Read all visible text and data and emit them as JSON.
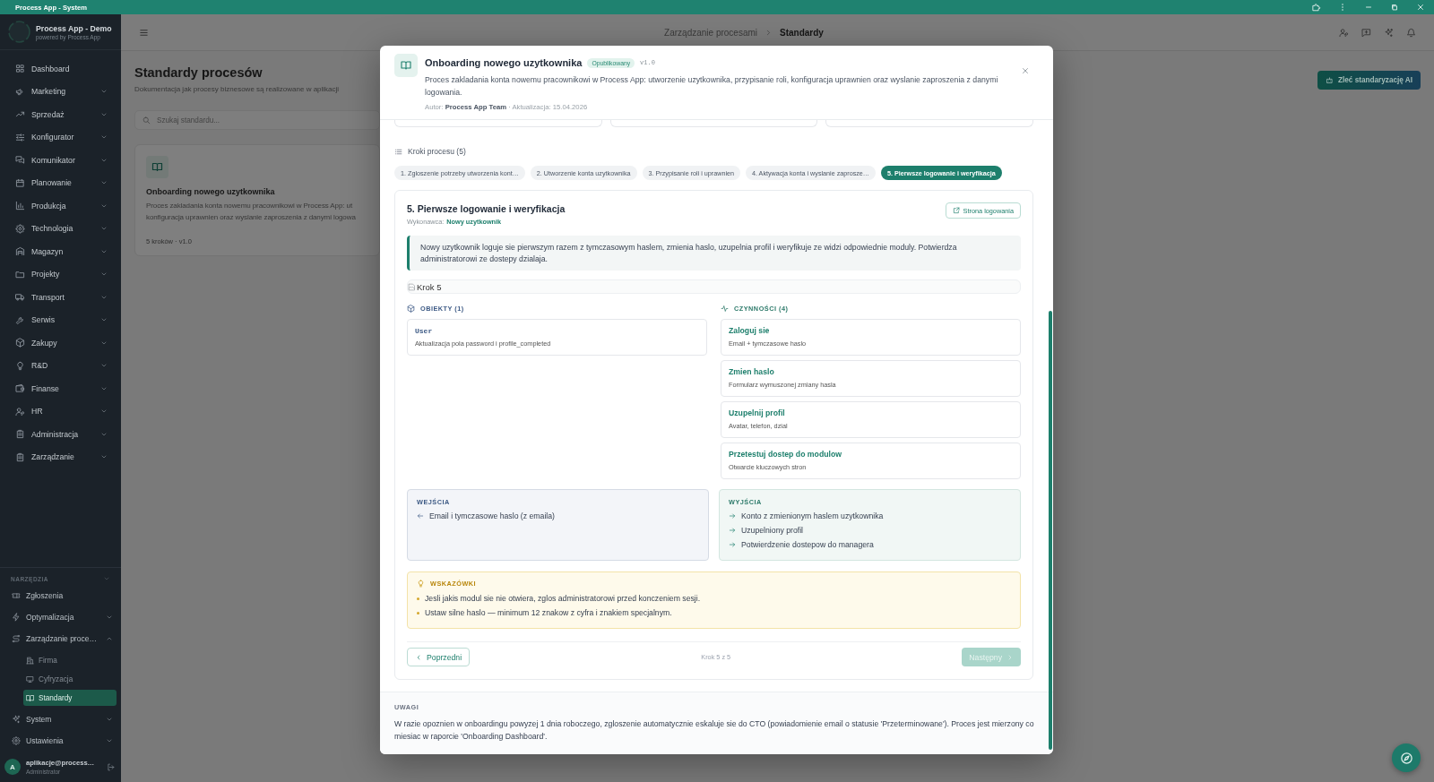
{
  "window": {
    "title": "Process App - System"
  },
  "sidebar": {
    "app_name": "Process App - Demo",
    "app_tagline": "powered by Process App",
    "items": [
      {
        "label": "Dashboard",
        "kind": "link",
        "selected": false
      },
      {
        "label": "Marketing",
        "kind": "group",
        "selected": false,
        "expanded": false
      },
      {
        "label": "Sprzedaż",
        "kind": "group",
        "selected": false,
        "expanded": false
      },
      {
        "label": "Konfigurator",
        "kind": "group",
        "selected": false,
        "expanded": false
      },
      {
        "label": "Komunikator",
        "kind": "group",
        "selected": false,
        "expanded": false
      },
      {
        "label": "Planowanie",
        "kind": "group",
        "selected": false,
        "expanded": false
      },
      {
        "label": "Produkcja",
        "kind": "group",
        "selected": false,
        "expanded": false
      },
      {
        "label": "Technologia",
        "kind": "group",
        "selected": false,
        "expanded": false
      },
      {
        "label": "Magazyn",
        "kind": "group",
        "selected": false,
        "expanded": false
      },
      {
        "label": "Projekty",
        "kind": "group",
        "selected": false,
        "expanded": false
      },
      {
        "label": "Transport",
        "kind": "group",
        "selected": false,
        "expanded": false
      },
      {
        "label": "Serwis",
        "kind": "group",
        "selected": false,
        "expanded": false
      },
      {
        "label": "Zakupy",
        "kind": "group",
        "selected": false,
        "expanded": false
      },
      {
        "label": "R&D",
        "kind": "group",
        "selected": false,
        "expanded": false
      },
      {
        "label": "Finanse",
        "kind": "group",
        "selected": false,
        "expanded": false
      },
      {
        "label": "HR",
        "kind": "group",
        "selected": false,
        "expanded": false
      },
      {
        "label": "Administracja",
        "kind": "group",
        "selected": false,
        "expanded": false
      },
      {
        "label": "Zarządzanie",
        "kind": "group",
        "selected": false,
        "expanded": false
      }
    ],
    "tools": {
      "heading": "NARZĘDZIA",
      "items": [
        {
          "label": "Zgłoszenia",
          "kind": "link",
          "selected": false
        },
        {
          "label": "Optymalizacja",
          "kind": "group",
          "selected": false,
          "expanded": false
        },
        {
          "label": "Zarządzanie proce…",
          "kind": "group",
          "selected": false,
          "expanded": true,
          "children": [
            {
              "label": "Firma",
              "selected": false
            },
            {
              "label": "Cyfryzacja",
              "selected": false
            },
            {
              "label": "Standardy",
              "selected": true
            }
          ]
        },
        {
          "label": "System",
          "kind": "group",
          "selected": false,
          "expanded": false
        },
        {
          "label": "Ustawienia",
          "kind": "group",
          "selected": false,
          "expanded": false
        }
      ]
    },
    "user": {
      "avatar": "A",
      "email": "aplikacje@process…",
      "role": "Administrator"
    }
  },
  "topbar": {
    "breadcrumb": [
      {
        "label": "Zarządzanie procesami",
        "current": false
      },
      {
        "label": "Standardy",
        "current": true
      }
    ]
  },
  "page": {
    "title": "Standardy procesów",
    "subtitle": "Dokumentacja jak procesy biznesowe są realizowane w aplikacji",
    "ai_button": "Zleć standaryzację AI",
    "search": {
      "placeholder": "Szukaj standardu..."
    },
    "cards": [
      {
        "title": "Onboarding nowego uzytkownika",
        "description_lines": [
          "Proces zakladania konta nowemu pracownikowi w Process App: ut",
          "konfiguracja uprawnien oraz wyslanie zaproszenia z danymi logowa"
        ],
        "meta": "5 kroków · v1.0"
      }
    ]
  },
  "modal": {
    "title": "Onboarding nowego uzytkownika",
    "status": "Opublikowany",
    "version": "v1.0",
    "description": "Proces zakladania konta nowemu pracownikowi w Process App: utworzenie uzytkownika, przypisanie roli, konfiguracja uprawnien oraz wyslanie zaproszenia z danymi logowania.",
    "meta": "Autor: **Process App Team** · Aktualizacja: 15.04.2026",
    "steps_heading": "Kroki procesu (5)",
    "steps": [
      {
        "label": "1. Zgloszenie potrzeby utworzenia kont…",
        "selected": false
      },
      {
        "label": "2. Utworzenie konta uzytkownika",
        "selected": false
      },
      {
        "label": "3. Przypisanie roli i uprawnien",
        "selected": false
      },
      {
        "label": "4. Aktywacja konta i wyslanie zaprosze…",
        "selected": false
      },
      {
        "label": "5. Pierwsze logowanie i weryfikacja",
        "selected": true
      }
    ],
    "step": {
      "title": "5. Pierwsze logowanie i weryfikacja",
      "performer_label": "Wykonawca:",
      "performer": "Nowy uzytkownik",
      "link_button": "Strona logowania",
      "description": "Nowy uzytkownik loguje sie pierwszym razem z tymczasowym haslem, zmienia haslo, uzupelnia profil i weryfikuje ze widzi odpowiednie moduly. Potwierdza administratorowi ze dostepy dzialaja.",
      "image_alt": "Krok 5",
      "objects": {
        "heading": "OBIEKTY (1)",
        "items": [
          {
            "name": "User",
            "description": "Aktualizacja pola password i profile_completed"
          }
        ]
      },
      "actions": {
        "heading": "CZYNNOŚCI (4)",
        "items": [
          {
            "title": "Zaloguj sie",
            "detail": "Email + tymczasowe haslo"
          },
          {
            "title": "Zmien haslo",
            "detail": "Formularz wymuszonej zmiany hasla"
          },
          {
            "title": "Uzupelnij profil",
            "detail": "Avatar, telefon, dzial"
          },
          {
            "title": "Przetestuj dostep do modulow",
            "detail": "Otwarcie kluczowych stron"
          }
        ]
      },
      "inputs": {
        "heading": "WEJŚCIA",
        "items": [
          "Email i tymczasowe haslo (z emaila)"
        ]
      },
      "outputs": {
        "heading": "WYJŚCIA",
        "items": [
          "Konto z zmienionym haslem uzytkownika",
          "Uzupelniony profil",
          "Potwierdzenie dostepow do managera"
        ]
      },
      "tips": {
        "heading": "WSKAZÓWKI",
        "items": [
          "Jesli jakis modul sie nie otwiera, zglos administratorowi przed konczeniem sesji.",
          "Ustaw silne haslo — minimum 12 znakow z cyfra i znakiem specjalnym."
        ]
      },
      "nav": {
        "previous": {
          "label": "Poprzedni",
          "disabled": false
        },
        "position": "Krok 5 z 5",
        "next": {
          "label": "Następny",
          "disabled": true
        }
      }
    },
    "notes": {
      "heading": "UWAGI",
      "text": "W razie opoznien w onboardingu powyzej 1 dnia roboczego, zgloszenie automatycznie eskaluje sie do CTO (powiadomienie email o statusie 'Przeterminowane'). Proces jest mierzony co miesiac w raporcie 'Onboarding Dashboard'."
    }
  }
}
